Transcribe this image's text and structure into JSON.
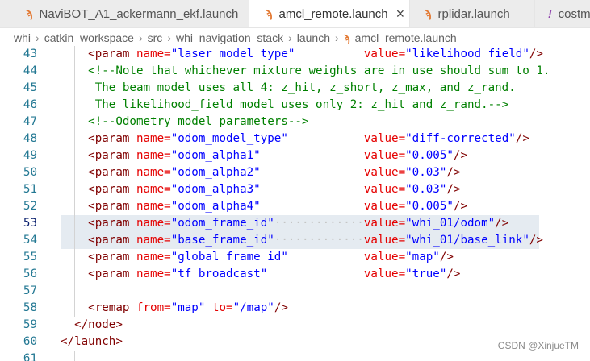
{
  "tabs": [
    {
      "label": "NaviBOT_A1_ackermann_ekf.launch",
      "icon": "rss-icon",
      "active": false
    },
    {
      "label": "amcl_remote.launch",
      "icon": "rss-icon",
      "active": true,
      "close": "×"
    },
    {
      "label": "rplidar.launch",
      "icon": "rss-icon",
      "active": false
    },
    {
      "label": "costm",
      "icon": "exclamation-icon",
      "active": false
    }
  ],
  "breadcrumb": [
    "whi",
    "catkin_workspace",
    "src",
    "whi_navigation_stack",
    "launch",
    "amcl_remote.launch"
  ],
  "lines": [
    {
      "n": "43",
      "parts": [
        [
          "tag",
          "<param "
        ],
        [
          "attr",
          "name="
        ],
        [
          "val",
          "\"laser_model_type\""
        ],
        [
          "txt",
          "          "
        ],
        [
          "attr",
          "value="
        ],
        [
          "val",
          "\"likelihood_field\""
        ],
        [
          "tag",
          "/>"
        ]
      ]
    },
    {
      "n": "44",
      "parts": [
        [
          "com",
          "<!--Note that whichever mixture weights are in use should sum to 1."
        ]
      ]
    },
    {
      "n": "45",
      "parts": [
        [
          "com",
          " The beam model uses all 4: z_hit, z_short, z_max, and z_rand."
        ]
      ]
    },
    {
      "n": "46",
      "parts": [
        [
          "com",
          " The likelihood_field model uses only 2: z_hit and z_rand.-->"
        ]
      ]
    },
    {
      "n": "47",
      "parts": [
        [
          "com",
          "<!--Odometry model parameters-->"
        ]
      ]
    },
    {
      "n": "48",
      "parts": [
        [
          "tag",
          "<param "
        ],
        [
          "attr",
          "name="
        ],
        [
          "val",
          "\"odom_model_type\""
        ],
        [
          "txt",
          "           "
        ],
        [
          "attr",
          "value="
        ],
        [
          "val",
          "\"diff-corrected\""
        ],
        [
          "tag",
          "/>"
        ]
      ]
    },
    {
      "n": "49",
      "parts": [
        [
          "tag",
          "<param "
        ],
        [
          "attr",
          "name="
        ],
        [
          "val",
          "\"odom_alpha1\""
        ],
        [
          "txt",
          "               "
        ],
        [
          "attr",
          "value="
        ],
        [
          "val",
          "\"0.005\""
        ],
        [
          "tag",
          "/>"
        ]
      ]
    },
    {
      "n": "50",
      "parts": [
        [
          "tag",
          "<param "
        ],
        [
          "attr",
          "name="
        ],
        [
          "val",
          "\"odom_alpha2\""
        ],
        [
          "txt",
          "               "
        ],
        [
          "attr",
          "value="
        ],
        [
          "val",
          "\"0.03\""
        ],
        [
          "tag",
          "/>"
        ]
      ]
    },
    {
      "n": "51",
      "parts": [
        [
          "tag",
          "<param "
        ],
        [
          "attr",
          "name="
        ],
        [
          "val",
          "\"odom_alpha3\""
        ],
        [
          "txt",
          "               "
        ],
        [
          "attr",
          "value="
        ],
        [
          "val",
          "\"0.03\""
        ],
        [
          "tag",
          "/>"
        ]
      ]
    },
    {
      "n": "52",
      "parts": [
        [
          "tag",
          "<param "
        ],
        [
          "attr",
          "name="
        ],
        [
          "val",
          "\"odom_alpha4\""
        ],
        [
          "txt",
          "               "
        ],
        [
          "attr",
          "value="
        ],
        [
          "val",
          "\"0.005\""
        ],
        [
          "tag",
          "/>"
        ]
      ]
    },
    {
      "n": "53",
      "parts": [
        [
          "tag",
          "<param "
        ],
        [
          "attr",
          "name="
        ],
        [
          "val",
          "\"odom_frame_id\""
        ],
        [
          "dots",
          "·············"
        ],
        [
          "attr",
          "value="
        ],
        [
          "val",
          "\"whi_01/odom\""
        ],
        [
          "tag",
          "/>"
        ]
      ],
      "highlight": true,
      "current": true
    },
    {
      "n": "54",
      "parts": [
        [
          "tag",
          "<param "
        ],
        [
          "attr",
          "name="
        ],
        [
          "val",
          "\"base_frame_id\""
        ],
        [
          "dots",
          "·············"
        ],
        [
          "attr",
          "value="
        ],
        [
          "val",
          "\"whi_01/base_link\""
        ],
        [
          "tag",
          "/>"
        ]
      ],
      "highlight": true
    },
    {
      "n": "55",
      "parts": [
        [
          "tag",
          "<param "
        ],
        [
          "attr",
          "name="
        ],
        [
          "val",
          "\"global_frame_id\""
        ],
        [
          "txt",
          "           "
        ],
        [
          "attr",
          "value="
        ],
        [
          "val",
          "\"map\""
        ],
        [
          "tag",
          "/>"
        ]
      ]
    },
    {
      "n": "56",
      "parts": [
        [
          "tag",
          "<param "
        ],
        [
          "attr",
          "name="
        ],
        [
          "val",
          "\"tf_broadcast\""
        ],
        [
          "txt",
          "              "
        ],
        [
          "attr",
          "value="
        ],
        [
          "val",
          "\"true\""
        ],
        [
          "tag",
          "/>"
        ]
      ]
    },
    {
      "n": "57",
      "parts": []
    },
    {
      "n": "58",
      "parts": [
        [
          "tag",
          "<remap "
        ],
        [
          "attr",
          "from="
        ],
        [
          "val",
          "\"map\""
        ],
        [
          "txt",
          " "
        ],
        [
          "attr",
          "to="
        ],
        [
          "val",
          "\"/map\""
        ],
        [
          "tag",
          "/>"
        ]
      ]
    },
    {
      "n": "59",
      "parts": [
        [
          "tag",
          "</node>"
        ]
      ],
      "indent": 1
    },
    {
      "n": "60",
      "parts": [
        [
          "tag",
          "</launch>"
        ]
      ],
      "indent": 0
    },
    {
      "n": "61",
      "parts": []
    }
  ],
  "watermark": "CSDN @XinjueTM",
  "colors": {
    "tag": "#800000",
    "attr": "#e50000",
    "value": "#0000ff",
    "comment": "#008000",
    "line_number": "#237893",
    "highlight": "#e5ebf1"
  }
}
